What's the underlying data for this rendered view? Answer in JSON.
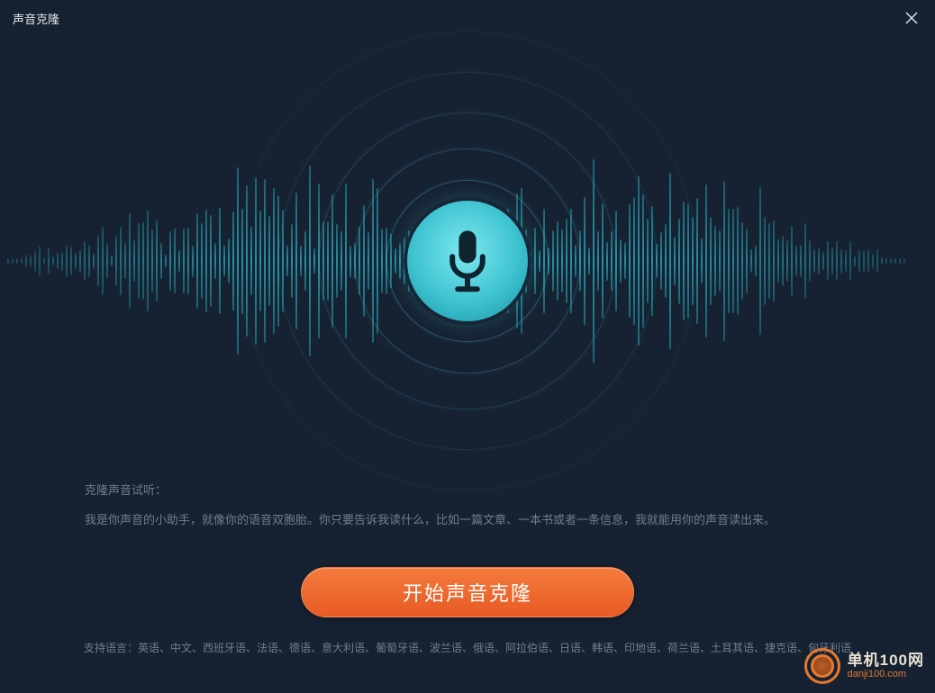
{
  "window": {
    "title": "声音克隆"
  },
  "mic": {
    "icon_name": "microphone-icon"
  },
  "sample": {
    "heading": "克隆声音试听：",
    "description": "我是你声音的小助手，就像你的语音双胞胎。你只要告诉我读什么，比如一篇文章、一本书或者一条信息，我就能用你的声音读出来。"
  },
  "cta": {
    "label": "开始声音克隆"
  },
  "languages": {
    "prefix": "支持语言：",
    "list": "英语、中文、西班牙语、法语、德语、意大利语、葡萄牙语、波兰语、俄语、阿拉伯语、日语、韩语、印地语、荷兰语、土耳其语、捷克语、匈牙利语"
  },
  "watermark": {
    "brand": "单机100网",
    "url": "danji100.com"
  },
  "colors": {
    "accent_teal": "#3ec3d1",
    "cta_orange": "#e75b24",
    "bg": "#162232"
  }
}
